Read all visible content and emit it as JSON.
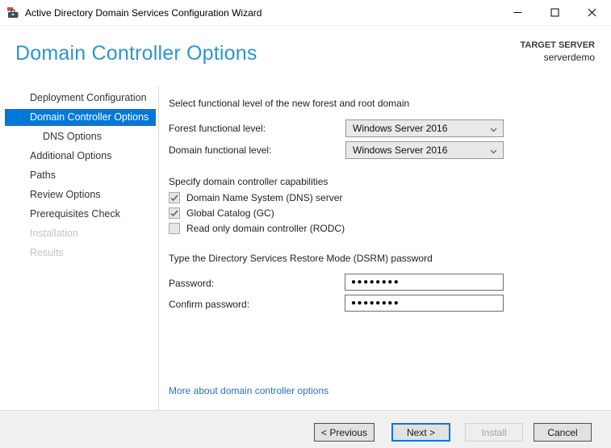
{
  "window": {
    "title": "Active Directory Domain Services Configuration Wizard"
  },
  "header": {
    "page_title": "Domain Controller Options",
    "target_server_label": "TARGET SERVER",
    "target_server_name": "serverdemo"
  },
  "sidebar": {
    "items": [
      {
        "label": "Deployment Configuration",
        "state": "normal"
      },
      {
        "label": "Domain Controller Options",
        "state": "selected"
      },
      {
        "label": "DNS Options",
        "state": "normal",
        "indent": 1
      },
      {
        "label": "Additional Options",
        "state": "normal"
      },
      {
        "label": "Paths",
        "state": "normal"
      },
      {
        "label": "Review Options",
        "state": "normal"
      },
      {
        "label": "Prerequisites Check",
        "state": "normal"
      },
      {
        "label": "Installation",
        "state": "disabled"
      },
      {
        "label": "Results",
        "state": "disabled"
      }
    ]
  },
  "content": {
    "functional_level": {
      "heading": "Select functional level of the new forest and root domain",
      "forest_label": "Forest functional level:",
      "forest_value": "Windows Server 2016",
      "domain_label": "Domain functional level:",
      "domain_value": "Windows Server 2016"
    },
    "capabilities": {
      "heading": "Specify domain controller capabilities",
      "checkboxes": [
        {
          "label": "Domain Name System (DNS) server",
          "checked": true,
          "enabled": false
        },
        {
          "label": "Global Catalog (GC)",
          "checked": true,
          "enabled": false
        },
        {
          "label": "Read only domain controller (RODC)",
          "checked": false,
          "enabled": false
        }
      ]
    },
    "dsrm": {
      "heading": "Type the Directory Services Restore Mode (DSRM) password",
      "password_label": "Password:",
      "password_value": "●●●●●●●●",
      "confirm_label": "Confirm password:",
      "confirm_value": "●●●●●●●●"
    },
    "link_label": "More about domain controller options"
  },
  "footer": {
    "buttons": [
      {
        "label": "< Previous",
        "state": "normal"
      },
      {
        "label": "Next >",
        "state": "default"
      },
      {
        "label": "Install",
        "state": "disabled"
      },
      {
        "label": "Cancel",
        "state": "normal"
      }
    ]
  },
  "colors": {
    "accent": "#0078D7",
    "page_title_blue": "#2E95C9",
    "link_blue": "#2A70BE",
    "selected_nav_bg": "#0078D7",
    "footer_bg": "#F0F0F0"
  }
}
